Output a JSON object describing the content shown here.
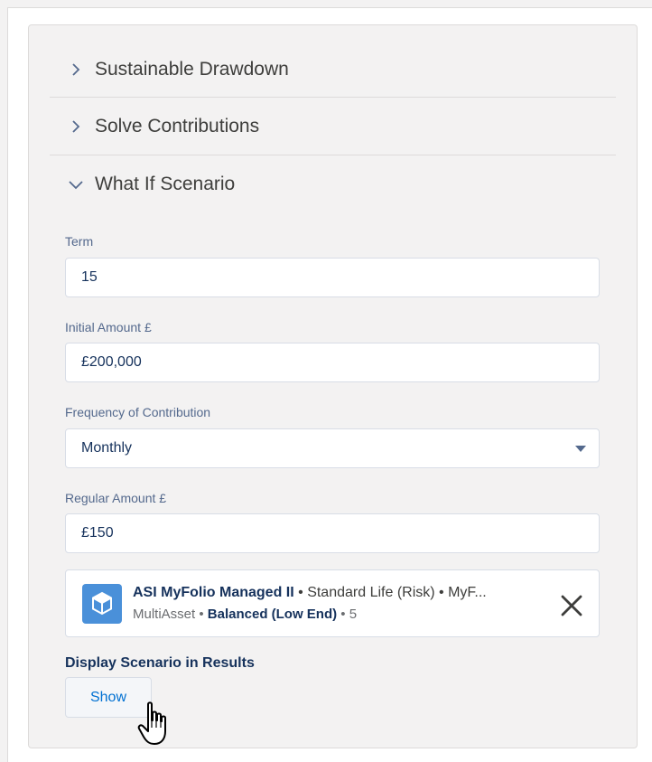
{
  "sections": [
    {
      "title": "Sustainable Drawdown",
      "expanded": false,
      "icon": "chevron-right-icon"
    },
    {
      "title": "Solve Contributions",
      "expanded": false,
      "icon": "chevron-right-icon"
    },
    {
      "title": "What If Scenario",
      "expanded": true,
      "icon": "chevron-down-icon"
    }
  ],
  "form": {
    "term": {
      "label": "Term",
      "value": "15"
    },
    "initial_amount": {
      "label": "Initial Amount £",
      "value": "£200,000"
    },
    "frequency": {
      "label": "Frequency of Contribution",
      "value": "Monthly"
    },
    "regular_amount": {
      "label": "Regular Amount £",
      "value": "£150"
    }
  },
  "fund": {
    "name": "ASI MyFolio Managed II",
    "sep1": " • ",
    "provider": "Standard Life (Risk)",
    "sep2": " • ",
    "abbrev": "MyF...",
    "asset_class": "MultiAsset",
    "sep3": " • ",
    "risk": "Balanced (Low End)",
    "sep4": " • ",
    "risk_level": "5",
    "icon": "cube-icon",
    "icon_color": "#4a90d9"
  },
  "display": {
    "label": "Display Scenario in Results",
    "button_label": "Show"
  },
  "colors": {
    "accent": "#0070d2",
    "background": "#f3f2f2"
  }
}
